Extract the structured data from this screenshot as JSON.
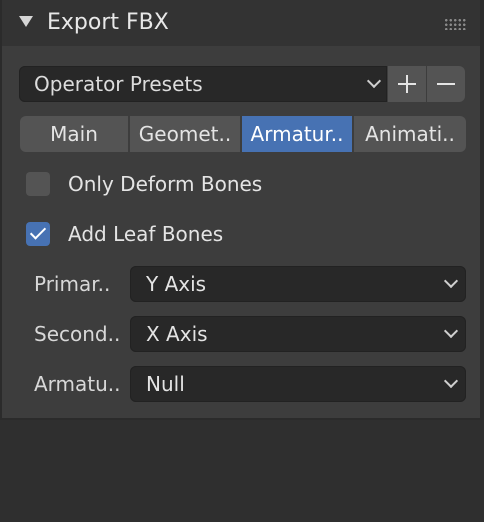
{
  "panel": {
    "title": "Export FBX"
  },
  "presets": {
    "label": "Operator Presets",
    "add_symbol": "+",
    "remove_symbol": "−"
  },
  "tabs": [
    {
      "label": "Main",
      "active": false
    },
    {
      "label": "Geomet..",
      "active": false
    },
    {
      "label": "Armatur..",
      "active": true
    },
    {
      "label": "Animati..",
      "active": false
    }
  ],
  "options": {
    "only_deform_bones": {
      "label": "Only Deform Bones",
      "checked": false
    },
    "add_leaf_bones": {
      "label": "Add Leaf Bones",
      "checked": true
    }
  },
  "properties": [
    {
      "label": "Primar..",
      "value": "Y Axis"
    },
    {
      "label": "Second..",
      "value": "X Axis"
    },
    {
      "label": "Armatu..",
      "value": "Null"
    }
  ],
  "colors": {
    "accent": "#4772b3",
    "panel_bg": "#3d3d3d",
    "header_bg": "#333333",
    "field_bg": "#282828",
    "button_bg": "#545454"
  },
  "icons": {
    "collapse": "disclosure-triangle-down-icon",
    "drag": "drag-grip-icon",
    "dropdown": "chevron-down-icon"
  }
}
